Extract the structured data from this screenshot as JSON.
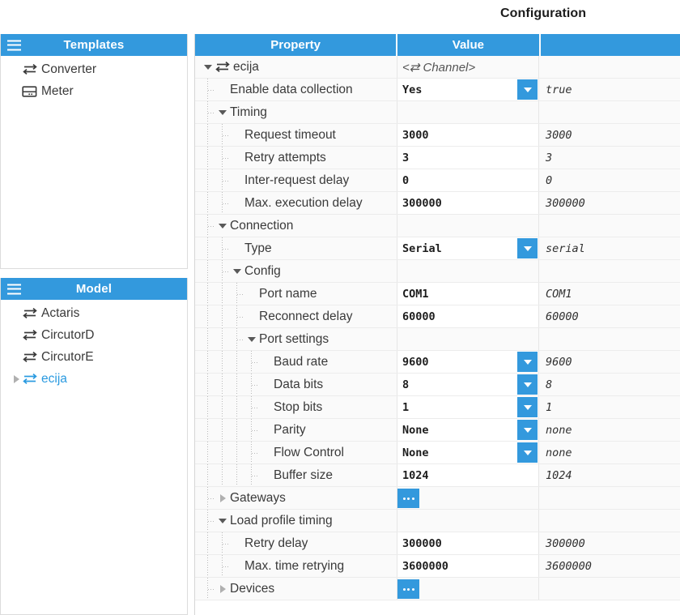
{
  "window": {
    "title": "Configuration"
  },
  "theme": {
    "accent": "#3399dd",
    "header_text": "#ffffff",
    "selected_item": "#2a9ae0",
    "row_alt": "#fafafa",
    "row_edit": "#ffffff"
  },
  "templates_panel": {
    "header": "Templates",
    "menu_icon": "hamburger-icon",
    "items": [
      {
        "label": "Converter",
        "icon": "converter-arrows-icon",
        "selected": false,
        "expander": "none"
      },
      {
        "label": "Meter",
        "icon": "meter-icon",
        "selected": false,
        "expander": "none"
      }
    ]
  },
  "model_panel": {
    "header": "Model",
    "menu_icon": "hamburger-icon",
    "items": [
      {
        "label": "Actaris",
        "icon": "converter-arrows-icon",
        "selected": false,
        "expander": "none"
      },
      {
        "label": "CircutorD",
        "icon": "converter-arrows-icon",
        "selected": false,
        "expander": "none"
      },
      {
        "label": "CircutorE",
        "icon": "converter-arrows-icon",
        "selected": false,
        "expander": "none"
      },
      {
        "label": "ecija",
        "icon": "converter-arrows-icon",
        "selected": true,
        "expander": "collapsed"
      }
    ]
  },
  "grid": {
    "columns": [
      "Property",
      "Value",
      ""
    ],
    "rows": [
      {
        "label": "ecija",
        "level": 0,
        "expander": "expanded",
        "icon": "converter-arrows-icon",
        "value": "<⇄ Channel>",
        "value_style": "placeholder",
        "default": "",
        "control": "none"
      },
      {
        "label": "Enable data collection",
        "level": 1,
        "expander": "leaf",
        "icon": "none",
        "value": "Yes",
        "value_style": "bold",
        "default": "true",
        "control": "dropdown"
      },
      {
        "label": "Timing",
        "level": 1,
        "expander": "expanded",
        "icon": "none",
        "value": "",
        "value_style": "none",
        "default": "",
        "control": "none"
      },
      {
        "label": "Request timeout",
        "level": 2,
        "expander": "leaf",
        "icon": "none",
        "value": "3000",
        "value_style": "bold",
        "default": "3000",
        "control": "text"
      },
      {
        "label": "Retry attempts",
        "level": 2,
        "expander": "leaf",
        "icon": "none",
        "value": "3",
        "value_style": "bold",
        "default": "3",
        "control": "text"
      },
      {
        "label": "Inter-request delay",
        "level": 2,
        "expander": "leaf",
        "icon": "none",
        "value": "0",
        "value_style": "bold",
        "default": "0",
        "control": "text"
      },
      {
        "label": "Max. execution delay",
        "level": 2,
        "expander": "leaf",
        "icon": "none",
        "value": "300000",
        "value_style": "bold",
        "default": "300000",
        "control": "text"
      },
      {
        "label": "Connection",
        "level": 1,
        "expander": "expanded",
        "icon": "none",
        "value": "",
        "value_style": "none",
        "default": "",
        "control": "none"
      },
      {
        "label": "Type",
        "level": 2,
        "expander": "leaf",
        "icon": "none",
        "value": "Serial",
        "value_style": "bold",
        "default": "serial",
        "control": "dropdown"
      },
      {
        "label": "Config",
        "level": 2,
        "expander": "expanded",
        "icon": "none",
        "value": "",
        "value_style": "none",
        "default": "",
        "control": "none"
      },
      {
        "label": "Port name",
        "level": 3,
        "expander": "leaf",
        "icon": "none",
        "value": "COM1",
        "value_style": "bold",
        "default": "COM1",
        "control": "text"
      },
      {
        "label": "Reconnect delay",
        "level": 3,
        "expander": "leaf",
        "icon": "none",
        "value": "60000",
        "value_style": "bold",
        "default": "60000",
        "control": "text"
      },
      {
        "label": "Port settings",
        "level": 3,
        "expander": "expanded",
        "icon": "none",
        "value": "",
        "value_style": "none",
        "default": "",
        "control": "none"
      },
      {
        "label": "Baud rate",
        "level": 4,
        "expander": "leaf",
        "icon": "none",
        "value": "9600",
        "value_style": "bold",
        "default": "9600",
        "control": "dropdown"
      },
      {
        "label": "Data bits",
        "level": 4,
        "expander": "leaf",
        "icon": "none",
        "value": "8",
        "value_style": "bold",
        "default": "8",
        "control": "dropdown"
      },
      {
        "label": "Stop bits",
        "level": 4,
        "expander": "leaf",
        "icon": "none",
        "value": "1",
        "value_style": "bold",
        "default": "1",
        "control": "dropdown"
      },
      {
        "label": "Parity",
        "level": 4,
        "expander": "leaf",
        "icon": "none",
        "value": "None",
        "value_style": "bold",
        "default": "none",
        "control": "dropdown"
      },
      {
        "label": "Flow Control",
        "level": 4,
        "expander": "leaf",
        "icon": "none",
        "value": "None",
        "value_style": "bold",
        "default": "none",
        "control": "dropdown"
      },
      {
        "label": "Buffer size",
        "level": 4,
        "expander": "leaf",
        "icon": "none",
        "value": "1024",
        "value_style": "bold",
        "default": "1024",
        "control": "text"
      },
      {
        "label": "Gateways",
        "level": 1,
        "expander": "collapsed",
        "icon": "none",
        "value": "",
        "value_style": "none",
        "default": "",
        "control": "ellipsis"
      },
      {
        "label": "Load profile timing",
        "level": 1,
        "expander": "expanded",
        "icon": "none",
        "value": "",
        "value_style": "none",
        "default": "",
        "control": "none"
      },
      {
        "label": "Retry delay",
        "level": 2,
        "expander": "leaf",
        "icon": "none",
        "value": "300000",
        "value_style": "bold",
        "default": "300000",
        "control": "text"
      },
      {
        "label": "Max. time retrying",
        "level": 2,
        "expander": "leaf",
        "icon": "none",
        "value": "3600000",
        "value_style": "bold",
        "default": "3600000",
        "control": "text"
      },
      {
        "label": "Devices",
        "level": 1,
        "expander": "collapsed",
        "icon": "none",
        "value": "",
        "value_style": "none",
        "default": "",
        "control": "ellipsis"
      }
    ]
  }
}
